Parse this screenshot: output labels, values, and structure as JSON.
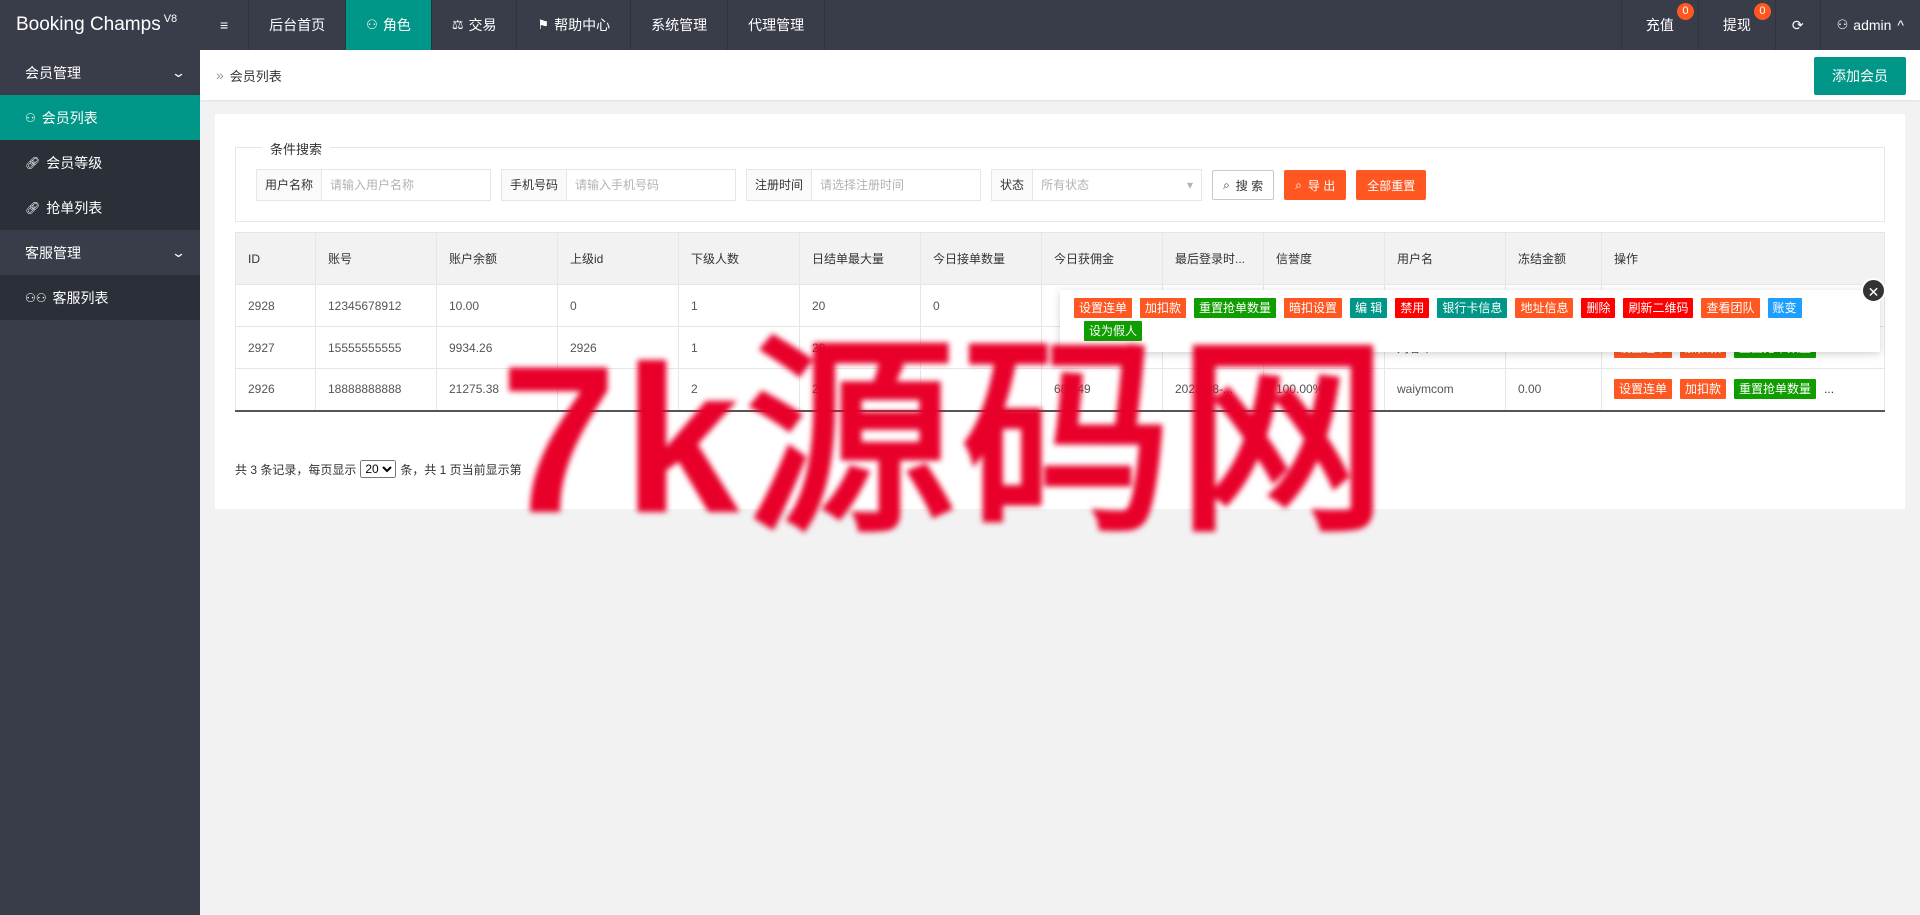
{
  "app": {
    "name": "Booking Champs",
    "version": "V8"
  },
  "topnav": {
    "menu_toggle": "≡",
    "items": [
      "后台首页",
      "角色",
      "交易",
      "帮助中心",
      "系统管理",
      "代理管理"
    ],
    "right": {
      "recharge": "充值",
      "recharge_badge": "0",
      "withdraw": "提现",
      "withdraw_badge": "0",
      "refresh": "⟳",
      "user": "admin"
    }
  },
  "sidebar": {
    "groups": [
      {
        "label": "会员管理",
        "items": [
          "会员列表",
          "会员等级",
          "抢单列表"
        ]
      },
      {
        "label": "客服管理",
        "items": [
          "客服列表"
        ]
      }
    ]
  },
  "breadcrumb": {
    "label": "会员列表",
    "add_button": "添加会员"
  },
  "search": {
    "legend": "条件搜索",
    "username_label": "用户名称",
    "username_placeholder": "请输入用户名称",
    "phone_label": "手机号码",
    "phone_placeholder": "请输入手机号码",
    "regtime_label": "注册时间",
    "regtime_placeholder": "请选择注册时间",
    "status_label": "状态",
    "status_value": "所有状态",
    "search_btn": "搜 索",
    "export_btn": "导 出",
    "reset_btn": "全部重置"
  },
  "table": {
    "headers": [
      "ID",
      "账号",
      "账户余额",
      "上级id",
      "下级人数",
      "日结单最大量",
      "今日接单数量",
      "今日获佣金",
      "最后登录时...",
      "信誉度",
      "用户名",
      "冻结金额",
      "操作"
    ],
    "rows": [
      [
        "2928",
        "12345678912",
        "10.00",
        "0",
        "1",
        "20",
        "0",
        "",
        "",
        "",
        "",
        "",
        ""
      ],
      [
        "2927",
        "15555555555",
        "9934.26",
        "2926",
        "1",
        "20",
        "",
        "",
        "2023-05-0...",
        "100.00%",
        "刘春华",
        "0.00",
        ""
      ],
      [
        "2926",
        "18888888888",
        "21275.38",
        "",
        "2",
        "20",
        "",
        "684.49",
        "2023-08-...",
        "100.00%",
        "waiymcom",
        "0.00",
        ""
      ]
    ],
    "row_actions": [
      "设置连单",
      "加扣款",
      "重置抢单数量"
    ],
    "more": "..."
  },
  "popup_actions": [
    "设置连单",
    "加扣款",
    "重置抢单数量",
    "暗扣设置",
    "编 辑",
    "禁用",
    "银行卡信息",
    "地址信息",
    "删除",
    "刷新二维码",
    "查看团队",
    "账变",
    "设为假人"
  ],
  "pager": {
    "prefix": "共 3 条记录，每页显示",
    "page_size": "20",
    "suffix": "条，共 1 页当前显示第"
  },
  "watermark": "7k源码网",
  "colors": {
    "topbar": "#393d49",
    "accent": "#009688",
    "orange": "#ff5722",
    "red": "#ff0000",
    "green": "#0f9d00",
    "blue": "#1e9fff"
  }
}
